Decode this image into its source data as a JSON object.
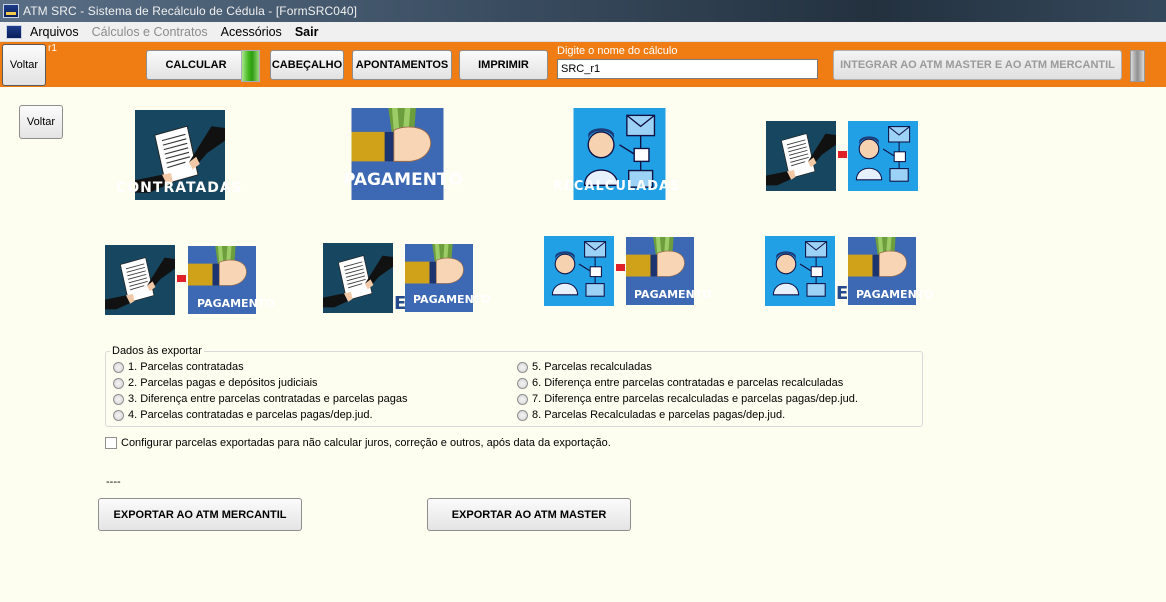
{
  "window": {
    "title": "ATM SRC - Sistema de Recálculo de Cédula  - [FormSRC040]"
  },
  "menu": [
    {
      "label": "Arquivos",
      "state": "normal"
    },
    {
      "label": "Cálculos e Contratos",
      "state": "disabled"
    },
    {
      "label": "Acessórios",
      "state": "normal"
    },
    {
      "label": "Sair",
      "state": "bold"
    }
  ],
  "toolbar": {
    "voltar": "Voltar",
    "superscript": "r1",
    "calcular": "CALCULAR",
    "cabecalho": "CABEÇALHO",
    "apontamentos": "APONTAMENTOS",
    "imprimir": "IMPRIMIR",
    "calc_name_label": "Digite o nome do cálculo",
    "calc_name_value": "SRC_r1",
    "integrar": "INTEGRAR AO ATM MASTER E AO ATM MERCANTIL",
    "accent": "#f07d14"
  },
  "voltar_left": "Voltar",
  "tiles": {
    "contratadas": "CONTRATADAS",
    "pagamento": "PAGAMENTO",
    "recalculadas": "RECALCULADAS",
    "e": "E"
  },
  "export_group": {
    "legend": "Dados às exportar",
    "options": [
      "1. Parcelas contratadas",
      "2. Parcelas pagas e depósitos judiciais",
      "3. Diferença entre parcelas contratadas e parcelas pagas",
      "4. Parcelas contratadas e parcelas pagas/dep.jud.",
      "5. Parcelas recalculadas",
      "6. Diferença entre parcelas contratadas e parcelas recalculadas",
      "7. Diferença entre parcelas recalculadas e parcelas pagas/dep.jud.",
      "8. Parcelas Recalculadas e parcelas pagas/dep.jud."
    ]
  },
  "checkbox_label": "Configurar parcelas exportadas para não calcular juros, correção e outros, após data da exportação.",
  "status_dashes": "----",
  "buttons": {
    "export_mercantil": "EXPORTAR AO ATM MERCANTIL",
    "export_master": "EXPORTAR AO ATM MASTER"
  }
}
